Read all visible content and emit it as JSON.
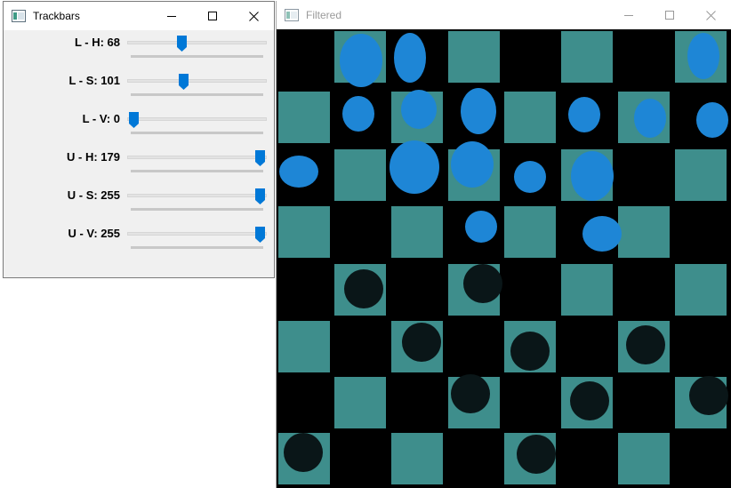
{
  "trackbars_window": {
    "title": "Trackbars",
    "sliders": [
      {
        "label": "L - H: 68",
        "value": 68,
        "max": 179
      },
      {
        "label": "L - S: 101",
        "value": 101,
        "max": 255
      },
      {
        "label": "L - V: 0",
        "value": 0,
        "max": 255
      },
      {
        "label": "U - H: 179",
        "value": 179,
        "max": 179
      },
      {
        "label": "U - S: 255",
        "value": 255,
        "max": 255
      },
      {
        "label": "U - V: 255",
        "value": 255,
        "max": 255
      }
    ]
  },
  "filtered_window": {
    "title": "Filtered"
  },
  "colors": {
    "accent": "#0078d7",
    "square": "#3e8e8c",
    "piece": "#1e86d6"
  },
  "icons": [
    "app-icon",
    "minimize-icon",
    "maximize-icon",
    "close-icon"
  ]
}
